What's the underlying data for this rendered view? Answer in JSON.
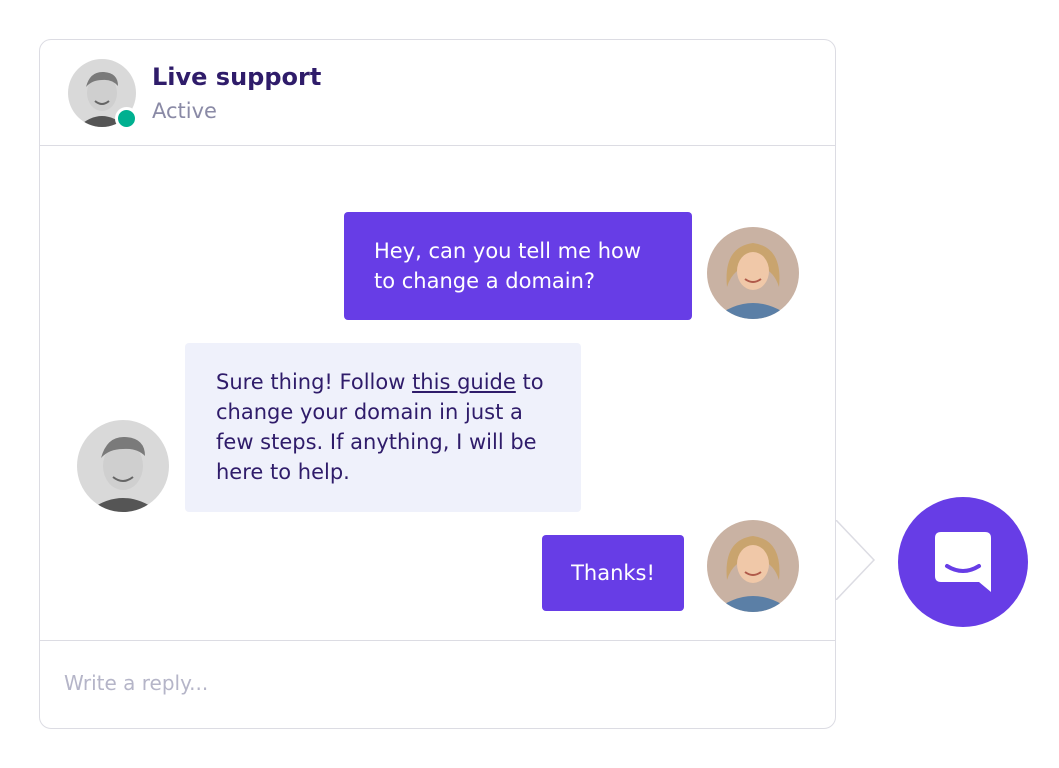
{
  "header": {
    "title": "Live support",
    "status": "Active"
  },
  "messages": [
    {
      "direction": "outgoing",
      "text": "Hey, can you tell me how to change a domain?"
    },
    {
      "direction": "incoming",
      "text_before": "Sure thing! Follow ",
      "link_text": "this guide",
      "text_after": " to change your domain in just a few steps. If anything, I will be here to help."
    },
    {
      "direction": "outgoing",
      "text": "Thanks!"
    }
  ],
  "composer": {
    "placeholder": "Write a reply..."
  },
  "colors": {
    "accent": "#673de6",
    "title_text": "#2f1c6a",
    "status_online": "#00b090",
    "incoming_bubble": "#eff1fb"
  },
  "icons": {
    "launcher": "chat-smile-icon",
    "status": "online-dot"
  }
}
